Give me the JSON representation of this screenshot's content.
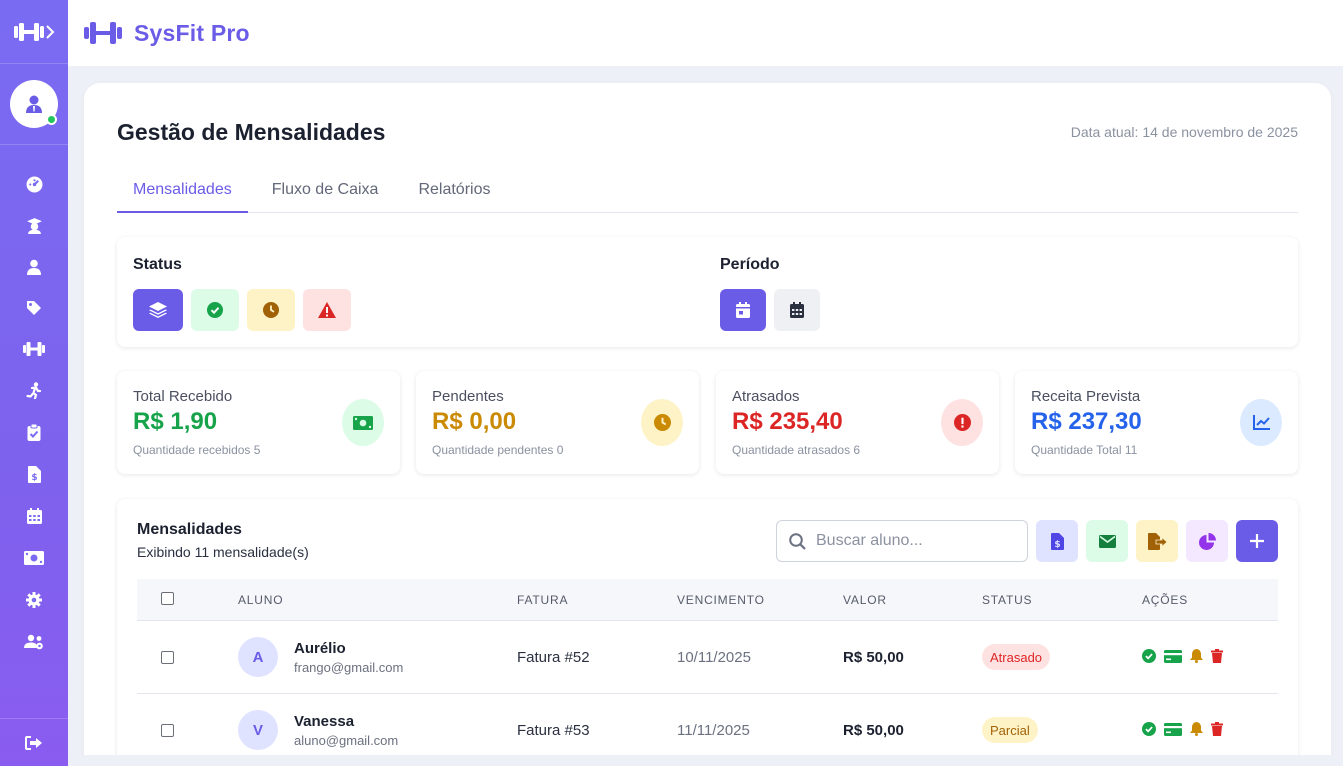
{
  "app": {
    "brand": "SysFit Pro"
  },
  "sidebar": {
    "items": [
      {
        "name": "dashboard-icon"
      },
      {
        "name": "graduation-cap-icon"
      },
      {
        "name": "user-icon"
      },
      {
        "name": "tag-icon"
      },
      {
        "name": "dumbbell-icon"
      },
      {
        "name": "running-icon"
      },
      {
        "name": "clipboard-check-icon"
      },
      {
        "name": "file-invoice-icon"
      },
      {
        "name": "calendar-icon"
      },
      {
        "name": "money-bill-icon"
      },
      {
        "name": "gear-icon"
      },
      {
        "name": "users-cog-icon"
      }
    ]
  },
  "page": {
    "title": "Gestão de Mensalidades",
    "date": "Data atual: 14 de novembro de 2025"
  },
  "tabs": [
    {
      "label": "Mensalidades",
      "active": true
    },
    {
      "label": "Fluxo de Caixa",
      "active": false
    },
    {
      "label": "Relatórios",
      "active": false
    }
  ],
  "filters": {
    "status_label": "Status",
    "period_label": "Período"
  },
  "stats": [
    {
      "label": "Total Recebido",
      "value": "R$ 1,90",
      "sub": "Quantidade recebidos 5",
      "color": "#16a34a",
      "icon_bg": "#dcfce7"
    },
    {
      "label": "Pendentes",
      "value": "R$ 0,00",
      "sub": "Quantidade pendentes 0",
      "color": "#ca8a04",
      "icon_bg": "#fef3c7"
    },
    {
      "label": "Atrasados",
      "value": "R$ 235,40",
      "sub": "Quantidade atrasados 6",
      "color": "#dc2626",
      "icon_bg": "#fee2e2"
    },
    {
      "label": "Receita Prevista",
      "value": "R$ 237,30",
      "sub": "Quantidade Total 11",
      "color": "#2563eb",
      "icon_bg": "#dbeafe"
    }
  ],
  "table": {
    "title": "Mensalidades",
    "subtitle": "Exibindo 11 mensalidade(s)",
    "search_placeholder": "Buscar aluno...",
    "headers": [
      "ALUNO",
      "FATURA",
      "VENCIMENTO",
      "VALOR",
      "STATUS",
      "AÇÕES"
    ],
    "rows": [
      {
        "initial": "A",
        "name": "Aurélio",
        "email": "frango@gmail.com",
        "invoice": "Fatura #52",
        "due": "10/11/2025",
        "value": "R$ 50,00",
        "status": "Atrasado"
      },
      {
        "initial": "V",
        "name": "Vanessa",
        "email": "aluno@gmail.com",
        "invoice": "Fatura #53",
        "due": "11/11/2025",
        "value": "R$ 50,00",
        "status": "Parcial"
      }
    ]
  },
  "colors": {
    "accent": "#6b5ce7",
    "sidebar": "#7a6cf2",
    "late_bg": "#fee2e2",
    "late_fg": "#dc2626",
    "partial_bg": "#fef3c7",
    "partial_fg": "#a16207"
  }
}
